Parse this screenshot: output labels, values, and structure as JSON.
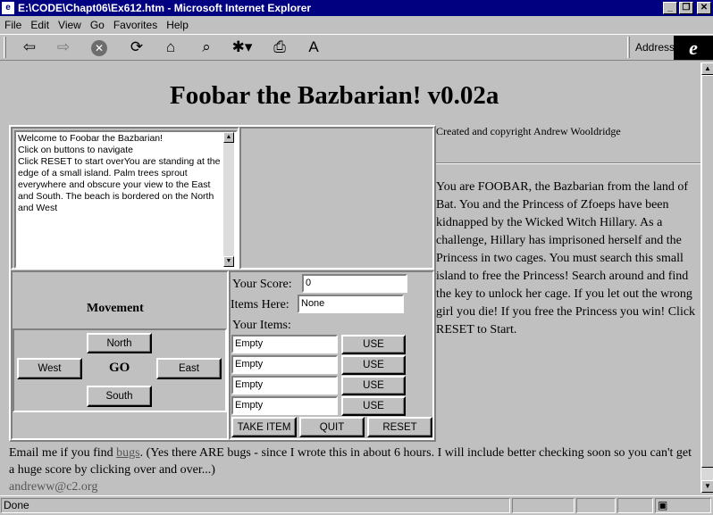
{
  "window": {
    "title": "E:\\CODE\\Chapt06\\Ex612.htm - Microsoft Internet Explorer"
  },
  "menu": [
    "File",
    "Edit",
    "View",
    "Go",
    "Favorites",
    "Help"
  ],
  "toolbar": {
    "address_label": "Address",
    "icons": [
      "back-icon",
      "forward-icon",
      "stop-icon",
      "refresh-icon",
      "home-icon",
      "search-icon",
      "favorites-icon",
      "print-icon",
      "font-icon"
    ]
  },
  "page": {
    "title": "Foobar the Bazbarian! v0.02a",
    "copyright": "Created and copyright Andrew Wooldridge",
    "log_text": "Welcome to Foobar the Bazbarian!\nClick on buttons to navigate\nClick RESET to start overYou are standing at the edge of a small island. Palm trees sprout everywhere and obscure your view to the East and South. The beach is bordered on the North and West",
    "story": "You are FOOBAR, the Bazbarian from the land of Bat. You and the Princess of Zfoeps have been kidnapped by the Wicked Witch Hillary. As a challenge, Hillary has imprisoned herself and the Princess in two cages. You must search this small island to free the Princess! Search around and find the key to unlock her cage. If you let out the wrong girl you die! If you free the Princess you win! Click RESET to Start.",
    "movement": {
      "label": "Movement",
      "north": "North",
      "west": "West",
      "go": "GO",
      "east": "East",
      "south": "South"
    },
    "status": {
      "score_label": "Your Score:",
      "score_value": "0",
      "items_here_label": "Items Here:",
      "items_here_value": "None",
      "your_items_label": "Your Items:",
      "items": [
        "Empty",
        "Empty",
        "Empty",
        "Empty"
      ],
      "use_label": "USE"
    },
    "actions": {
      "take": "TAKE ITEM",
      "quit": "QUIT",
      "reset": "RESET"
    },
    "footer": {
      "prefix": "Email me if you find ",
      "link": "bugs",
      "suffix": ". (Yes there ARE bugs - since I wrote this in about 6 hours. I will include better checking soon so you can't get a huge score by clicking over and over...)",
      "email": "andreww@c2.org"
    }
  },
  "statusbar": {
    "text": "Done"
  }
}
